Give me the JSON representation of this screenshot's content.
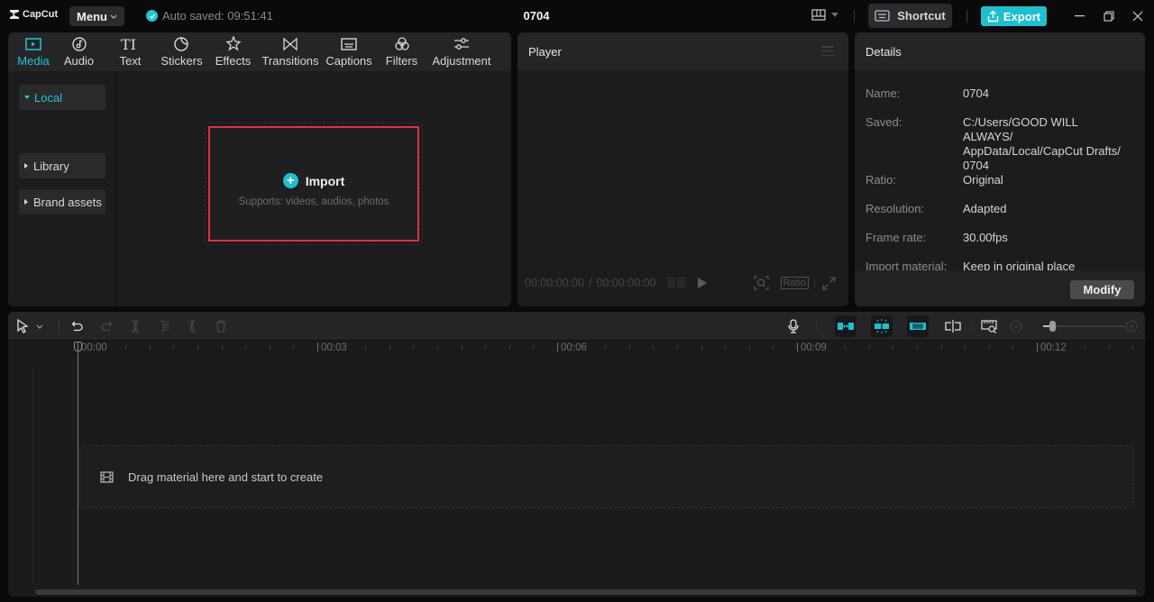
{
  "app": {
    "name": "CapCut",
    "menu_label": "Menu",
    "autosave_text": "Auto saved: 09:51:41",
    "project_title": "0704",
    "shortcut_label": "Shortcut",
    "export_label": "Export",
    "accent_color": "#1fbfcf",
    "highlight_color": "#e0323f"
  },
  "media_tabs": [
    {
      "label": "Media",
      "icon": "media-icon",
      "active": true
    },
    {
      "label": "Audio",
      "icon": "audio-icon",
      "active": false
    },
    {
      "label": "Text",
      "icon": "text-icon",
      "active": false
    },
    {
      "label": "Stickers",
      "icon": "stickers-icon",
      "active": false
    },
    {
      "label": "Effects",
      "icon": "effects-icon",
      "active": false
    },
    {
      "label": "Transitions",
      "icon": "transitions-icon",
      "active": false
    },
    {
      "label": "Captions",
      "icon": "captions-icon",
      "active": false
    },
    {
      "label": "Filters",
      "icon": "filters-icon",
      "active": false
    },
    {
      "label": "Adjustment",
      "icon": "adjustment-icon",
      "active": false
    }
  ],
  "media_sidebar": {
    "local": "Local",
    "import": "Import",
    "library": "Library",
    "brand_assets": "Brand assets"
  },
  "import_box": {
    "title": "Import",
    "subtitle": "Supports: videos, audios, photos"
  },
  "player": {
    "title": "Player",
    "current_time": "00:00:00:00",
    "total_time": "00:00:00:00",
    "time_separator": "/",
    "ratio_label": "Ratio"
  },
  "details": {
    "title": "Details",
    "rows": [
      {
        "label": "Name:",
        "value": "0704"
      },
      {
        "label": "Saved:",
        "value": "C:/Users/GOOD WILL ALWAYS/ AppData/Local/CapCut Drafts/ 0704"
      },
      {
        "label": "Ratio:",
        "value": "Original"
      },
      {
        "label": "Resolution:",
        "value": "Adapted"
      },
      {
        "label": "Frame rate:",
        "value": "30.00fps"
      },
      {
        "label": "Import material:",
        "value": "Keep in original place"
      }
    ],
    "modify_label": "Modify"
  },
  "timeline": {
    "ruler_labels": [
      "00:00",
      "00:03",
      "00:06",
      "00:09",
      "00:12"
    ],
    "drop_hint": "Drag material here and start to create",
    "zoom_level": 0.08
  }
}
